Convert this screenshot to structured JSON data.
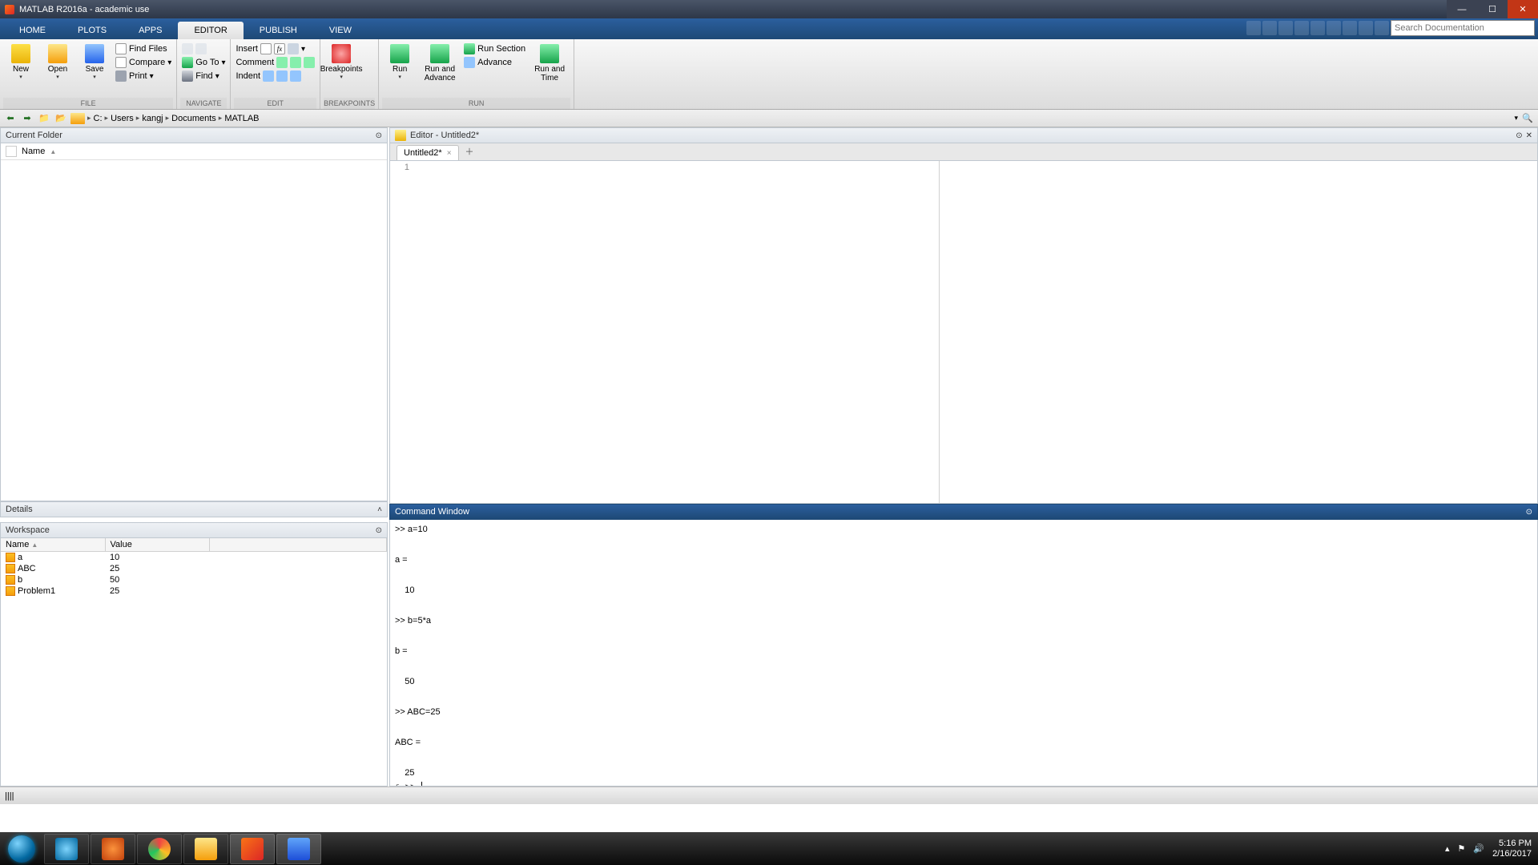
{
  "title": "MATLAB R2016a - academic use",
  "tabs": [
    "HOME",
    "PLOTS",
    "APPS",
    "EDITOR",
    "PUBLISH",
    "VIEW"
  ],
  "active_tab": 3,
  "ribbon": {
    "file": {
      "label": "FILE",
      "new": "New",
      "open": "Open",
      "save": "Save",
      "find_files": "Find Files",
      "compare": "Compare",
      "print": "Print"
    },
    "navigate": {
      "label": "NAVIGATE",
      "goto": "Go To",
      "find": "Find"
    },
    "edit": {
      "label": "EDIT",
      "insert": "Insert",
      "comment": "Comment",
      "indent": "Indent"
    },
    "breakpoints": {
      "label": "BREAKPOINTS",
      "breakpoints": "Breakpoints"
    },
    "run": {
      "label": "RUN",
      "run": "Run",
      "run_advance": "Run and\nAdvance",
      "run_section": "Run Section",
      "advance": "Advance",
      "run_time": "Run and\nTime"
    }
  },
  "search_placeholder": "Search Documentation",
  "path": [
    "C:",
    "Users",
    "kangj",
    "Documents",
    "MATLAB"
  ],
  "panels": {
    "current_folder": "Current Folder",
    "name_col": "Name",
    "details": "Details",
    "workspace": "Workspace",
    "editor": "Editor - Untitled2*",
    "command": "Command Window"
  },
  "editor_tab": "Untitled2*",
  "line_no": "1",
  "workspace_cols": [
    "Name",
    "Value"
  ],
  "workspace_vars": [
    {
      "name": "a",
      "value": "10"
    },
    {
      "name": "ABC",
      "value": "25"
    },
    {
      "name": "b",
      "value": "50"
    },
    {
      "name": "Problem1",
      "value": "25"
    }
  ],
  "cmd_output": ">> a=10\n\na =\n\n    10\n\n>> b=5*a\n\nb =\n\n    50\n\n>> ABC=25\n\nABC =\n\n    25\n",
  "cmd_prompt": ">> ",
  "fx_label": "fx",
  "statusbar": "||||",
  "tray": {
    "time": "5:16 PM",
    "date": "2/16/2017"
  },
  "sort_arrow": "▲"
}
